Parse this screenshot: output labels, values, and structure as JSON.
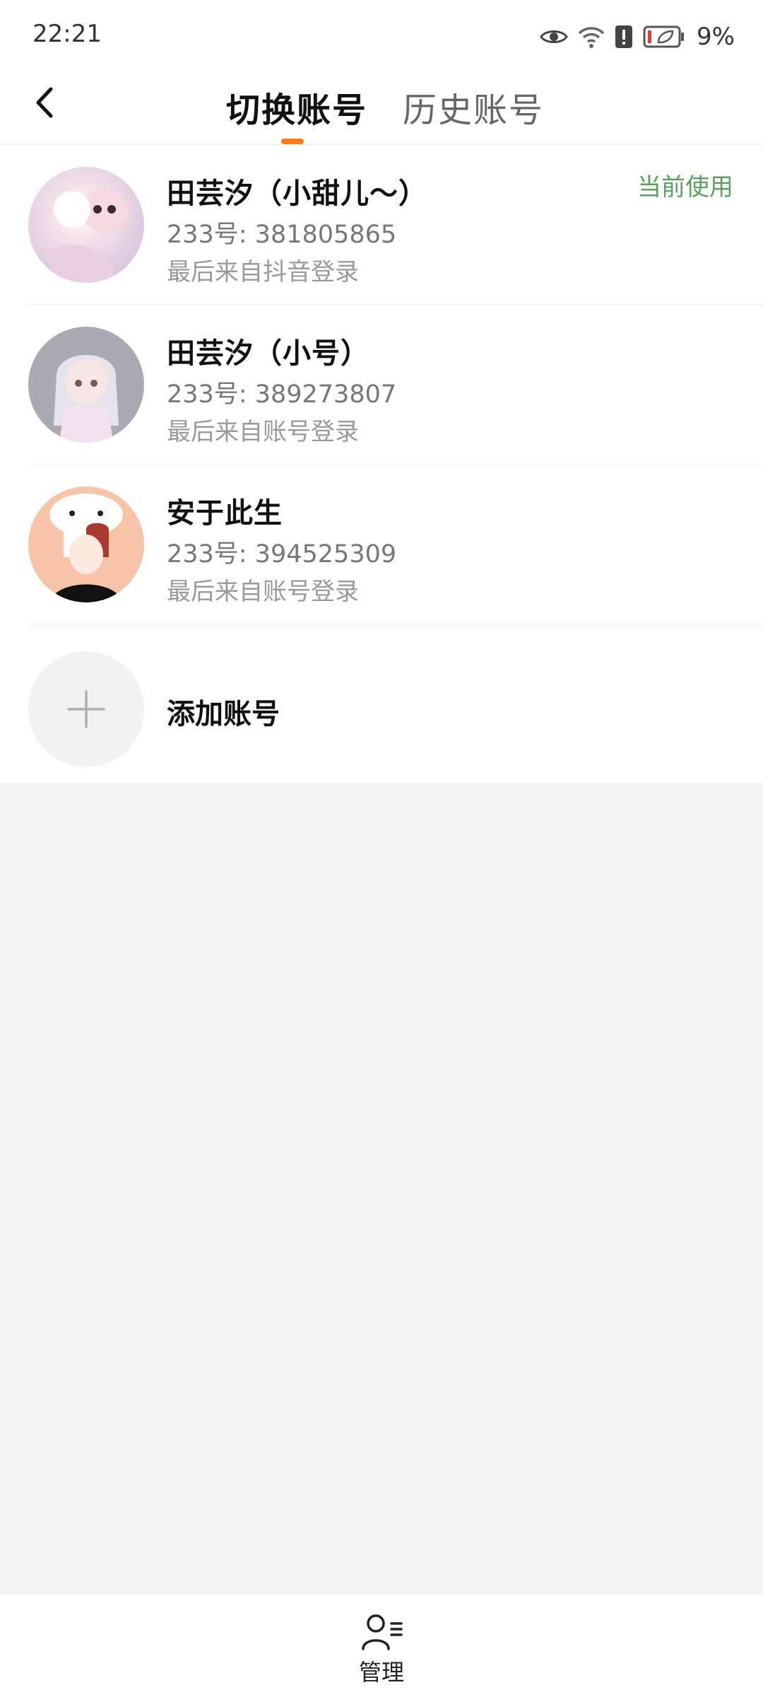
{
  "status_bar": {
    "time": "22:21",
    "battery": "9%"
  },
  "header": {
    "tabs": [
      "切换账号",
      "历史账号"
    ],
    "active_tab": 0
  },
  "accounts": [
    {
      "name": "田芸汐（小甜儿～）",
      "id": "233号: 381805865",
      "source": "最后来自抖音登录",
      "tag": "当前使用"
    },
    {
      "name": "田芸汐（小号）",
      "id": "233号: 389273807",
      "source": "最后来自账号登录"
    },
    {
      "name": "安于此生",
      "id": "233号: 394525309",
      "source": "最后来自账号登录"
    }
  ],
  "add_account": {
    "label": "添加账号"
  },
  "bottom_bar": {
    "manage_label": "管理"
  },
  "colors": {
    "accent": "#ff7a1a",
    "current_tag": "#57a35d",
    "page_bg": "#f4f4f4"
  },
  "icons": [
    "eye-icon",
    "wifi-icon",
    "alert-icon",
    "battery-icon",
    "back-arrow-icon",
    "plus-icon",
    "manage-user-icon"
  ]
}
